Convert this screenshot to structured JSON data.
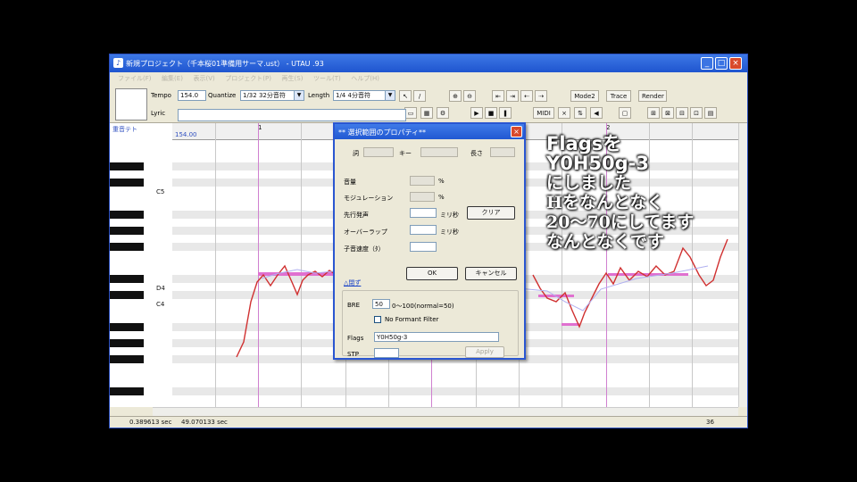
{
  "window": {
    "title": "新規プロジェクト（千本桜01準備用サーマ.ust） - UTAU .93"
  },
  "menu": [
    "ファイル(F)",
    "編集(E)",
    "表示(V)",
    "プロジェクト(P)",
    "再生(S)",
    "ツール(T)",
    "ヘルプ(H)"
  ],
  "toolbar": {
    "tempo_label": "Tempo",
    "tempo_value": "154.0",
    "quantize_label": "Quantize",
    "quantize_value": "1/32 32分音符",
    "length_label": "Length",
    "length_value": "1/4 4分音符",
    "lyric_label": "Lyric",
    "mode2": "Mode2",
    "trace": "Trace",
    "render": "Render",
    "midi": "MIDI"
  },
  "pianoroll": {
    "singer": "重音テト",
    "tempo_marker": "154.00",
    "measure_1": "1",
    "measure_2": "2",
    "notes": [
      "C5",
      "D4",
      "C4"
    ]
  },
  "dialog": {
    "title": "** 選択範囲のプロパティ**",
    "lyric_label": "詞",
    "key_label": "キー",
    "length_label": "長さ",
    "volume_label": "音量",
    "modulation_label": "モジュレーション",
    "preutterance_label": "先行発声",
    "overlap_label": "オーバーラップ",
    "consonant_label": "子音速度（ﾀ）",
    "ms_unit": "ミリ秒",
    "percent_unit": "%",
    "clear_button": "クリア",
    "ok_button": "OK",
    "cancel_button": "キャンセル",
    "shrink_link": "△閉ず",
    "bre_label": "BRE",
    "bre_value": "50",
    "bre_hint": "0〜100(normal=50)",
    "no_formant_label": "No Formant Filter",
    "flags_label": "Flags",
    "flags_value": "Y0H50g-3",
    "stp_label": "STP",
    "apply_button": "Apply"
  },
  "status": {
    "left": "0.389613 sec",
    "mid": "49.070133 sec",
    "right": "36"
  },
  "overlay": {
    "line1": "Flagsを",
    "line2": "Y0H50g-3",
    "line3": "にしました",
    "line4": "Hをなんとなく",
    "line5": "20〜70にしてます",
    "line6": "なんとなくです"
  }
}
